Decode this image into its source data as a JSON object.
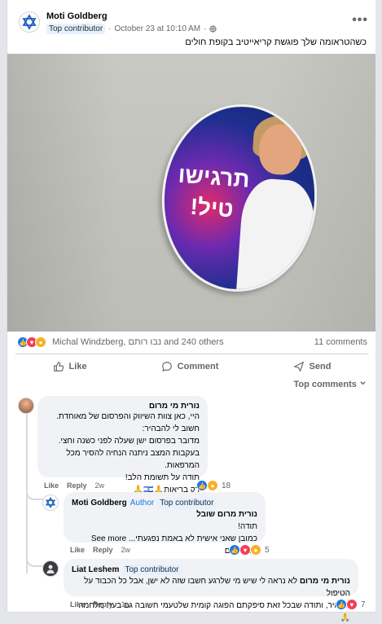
{
  "post": {
    "author": "Moti Goldberg",
    "badge": "Top contributor",
    "timestamp": "October 23 at 10:10 AM",
    "separator": "·",
    "more": "•••",
    "caption": "כשהטראומה שלך פוגשת קריאייטיב בקופת חולים",
    "sign_text": "תרגישו טיל!"
  },
  "reactions": {
    "names": "Michal Windzberg, נבו רותם and 240 others",
    "comments": "11 comments"
  },
  "actions": {
    "like": "Like",
    "comment": "Comment",
    "send": "Send"
  },
  "sort": "Top comments",
  "comments": [
    {
      "author": "נורית מי מרום",
      "lines": [
        "היי, כאן צוות השיווק והפרסום של מאוחדת.",
        "חשוב לי להבהיר:",
        "מדובר בפרסום ישן שעלה לפני כשנה וחצי.",
        "בעקבות המצב ניתנה הנחיה להסיר מכל המרפאות.",
        "תודה על תשומת הלב!",
        "רק בריאות🙏🇮🇱🙏"
      ],
      "like": "Like",
      "reply": "Reply",
      "age": "2w",
      "count": "18"
    },
    {
      "author": "Moti Goldberg",
      "author_tag": "Author",
      "badge": "Top contributor",
      "lines": [
        "נורית מרום שובל",
        "תודה!",
        "See more ...כמובן שאני אישית לא באמת נפגעתי מהפרסום"
      ],
      "like": "Like",
      "reply": "Reply",
      "age": "2w",
      "count": "5"
    },
    {
      "author": "Liat Leshem",
      "badge": "Top contributor",
      "mention": "נורית מי מרום",
      "lines": [
        "לא נראה לי שיש מי שלרגע חשבו שזה לא ישן, אבל כל הכבוד על הטיפול",
        "המהיר, ותודה שבכל זאת סיפקתם הפוגה קומית שלטעמי חשובה גם בעת מלחמה 🙏"
      ],
      "like": "Like",
      "reply": "Reply",
      "age": "1w",
      "count": "7"
    }
  ],
  "colors": {
    "accent": "#1877f2",
    "bubble": "#f0f2f5",
    "muted": "#65676b"
  },
  "icons": [
    "star-of-david-icon",
    "globe-icon",
    "like-icon",
    "comment-icon",
    "send-icon",
    "chevron-down-icon"
  ]
}
